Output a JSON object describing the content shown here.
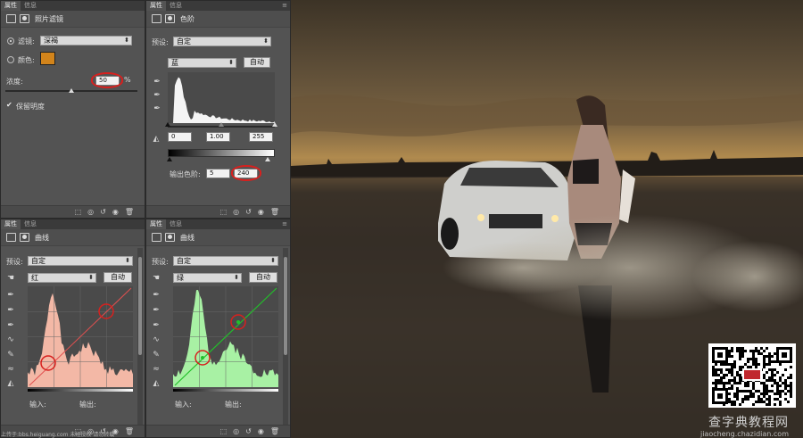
{
  "tabs": {
    "properties": "属性",
    "info": "信息",
    "menu": "≡"
  },
  "photo_filter": {
    "title": "照片滤镜",
    "filter_label": "滤镜:",
    "filter_value": "深褐",
    "color_label": "颜色:",
    "color_value": "#d2841b",
    "density_label": "浓度:",
    "density_value": "50",
    "density_unit": "%",
    "density_level": 0.5,
    "preserve_luminosity": "保留明度"
  },
  "levels": {
    "title": "色阶",
    "preset_label": "预设:",
    "preset_value": "自定",
    "channel_value": "蓝",
    "auto_label": "自动",
    "input_black": "0",
    "input_gamma": "1.00",
    "input_white": "255",
    "output_label": "输出色阶:",
    "output_black": "5",
    "output_white": "240"
  },
  "curves_red": {
    "title": "曲线",
    "preset_label": "预设:",
    "preset_value": "自定",
    "channel_value": "红",
    "auto_label": "自动",
    "input_label": "输入:",
    "output_label": "输出:",
    "histogram_color": "#f3b8a6",
    "curve_color": "#e05050"
  },
  "curves_green": {
    "title": "曲线",
    "preset_label": "预设:",
    "preset_value": "自定",
    "channel_value": "绿",
    "auto_label": "自动",
    "input_label": "输入:",
    "output_label": "输出:",
    "histogram_color": "#a8f1a4",
    "curve_color": "#22c02a"
  },
  "footer_icons": [
    "clip-icon",
    "eye-preview-icon",
    "reset-icon",
    "visibility-icon",
    "trash-icon"
  ],
  "footer_glyphs": [
    "⬚",
    "◎",
    "↺",
    "◉",
    "🗑"
  ],
  "canvas": {
    "watermark": "上传于:bbs.heiguang.com 未经授权 请勿转载",
    "brand": "查字典教程网",
    "site": "jiaocheng.chazidian.com"
  }
}
